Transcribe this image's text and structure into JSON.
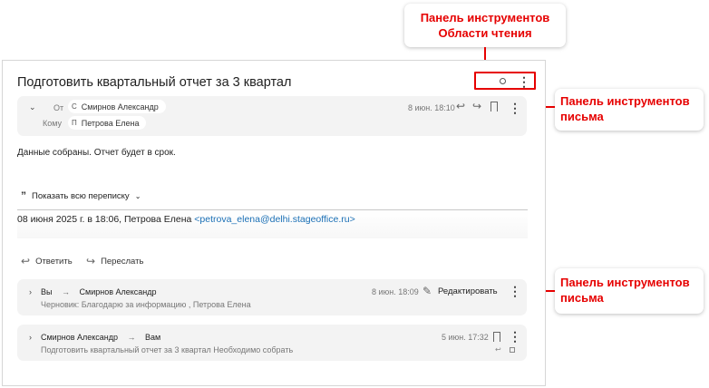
{
  "callouts": {
    "reading_toolbar": "Панель инструментов Области чтения",
    "message_toolbar_1": "Панель инструментов письма",
    "message_toolbar_2": "Панель инструментов письма"
  },
  "reading_pane": {
    "subject": "Подготовить квартальный отчет за 3 квартал",
    "toolbar": {
      "status_icon": "circle-icon",
      "more_icon": "⋮"
    }
  },
  "open_message": {
    "from_label": "От",
    "from_initial": "С",
    "from_name": "Смирнов Александр",
    "to_label": "Кому",
    "to_initial": "П",
    "to_name": "Петрова Елена",
    "date": "8 июн. 18:10",
    "body": "Данные собраны. Отчет будет в срок.",
    "show_all": "Показать всю переписку",
    "quote_header_prefix": "08 июня 2025 г. в 18:06, Петрова Елена ",
    "quote_header_email": "<petrova_elena@delhi.stageoffice.ru>"
  },
  "actions": {
    "reply": "Ответить",
    "forward": "Переслать"
  },
  "thread": [
    {
      "from": "Вы",
      "to": "Смирнов Александр",
      "date": "8 июн. 18:09",
      "edit_label": "Редактировать",
      "preview": "Черновик: Благодарю за информацию , Петрова Елена"
    },
    {
      "from": "Смирнов Александр",
      "to": "Вам",
      "date": "5 июн. 17:32",
      "preview": "Подготовить квартальный отчет за 3 квартал Необходимо собрать"
    }
  ],
  "colors": {
    "accent_red": "#e60000",
    "link": "#1a6fb5",
    "card_bg": "#f3f3f3"
  }
}
